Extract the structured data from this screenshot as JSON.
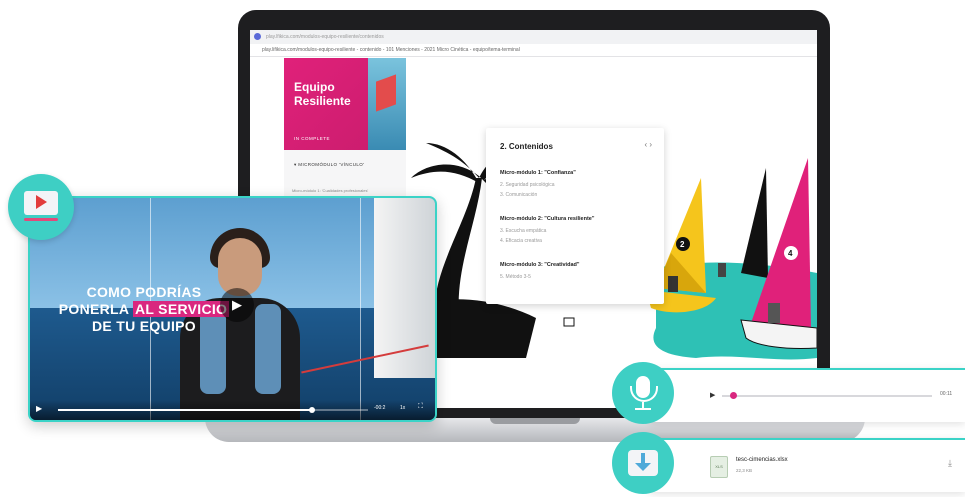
{
  "browser": {
    "tab_text": "play.lfikica.com/modulos-equipo-resiliente/contenidos",
    "url": "play.lifikica.com/modulos-equipo-resiliente - contenido - 101 Menciones - 2021 Micro Cinética - equipo/tema-terminal"
  },
  "course": {
    "title": "Equipo Resiliente",
    "status": "IN COMPLETE",
    "module_heading": "▾ MICROMÓDULO 'VÍNCULO'",
    "sidebar_row": "Micro-módulo 1: 'Cualidades profesionales'"
  },
  "contents_card": {
    "title": "2. Contenidos",
    "nav": "‹ ›",
    "modules": [
      {
        "title": "Micro-módulo 1: \"Confianza\"",
        "items": [
          "2. Seguridad psicológica",
          "3. Comunicación"
        ]
      },
      {
        "title": "Micro-módulo 2: \"Cultura resiliente\"",
        "items": [
          "3. Escucha empática",
          "4. Eficacia creativa"
        ]
      },
      {
        "title": "Micro-módulo 3: \"Creatividad\"",
        "items": [
          "5. Método 3-5"
        ]
      }
    ]
  },
  "illustration": {
    "sail_badge_1": "2",
    "sail_badge_2": "4"
  },
  "video": {
    "caption_line1": "COMO PODRÍAS",
    "caption_line2_a": "PONERLA ",
    "caption_line2_highlight": "AL SERVICIO",
    "caption_line3": "DE TU EQUIPO",
    "play_symbol": "▶",
    "time_left": "-00:2",
    "speed": "1x",
    "fullscreen_symbol": "⛶",
    "progress": 0.82
  },
  "audio": {
    "play_symbol": "▶",
    "time": "00:11",
    "progress": 0.05
  },
  "file": {
    "icon_label": "XLS",
    "name": "tesc-cimencias.xlsx",
    "size": "22,3 KB",
    "download_symbol": "⤓"
  },
  "colors": {
    "accent_teal": "#3ecfc4",
    "brand_pink": "#d9277f",
    "sail_yellow": "#f5c51c"
  }
}
